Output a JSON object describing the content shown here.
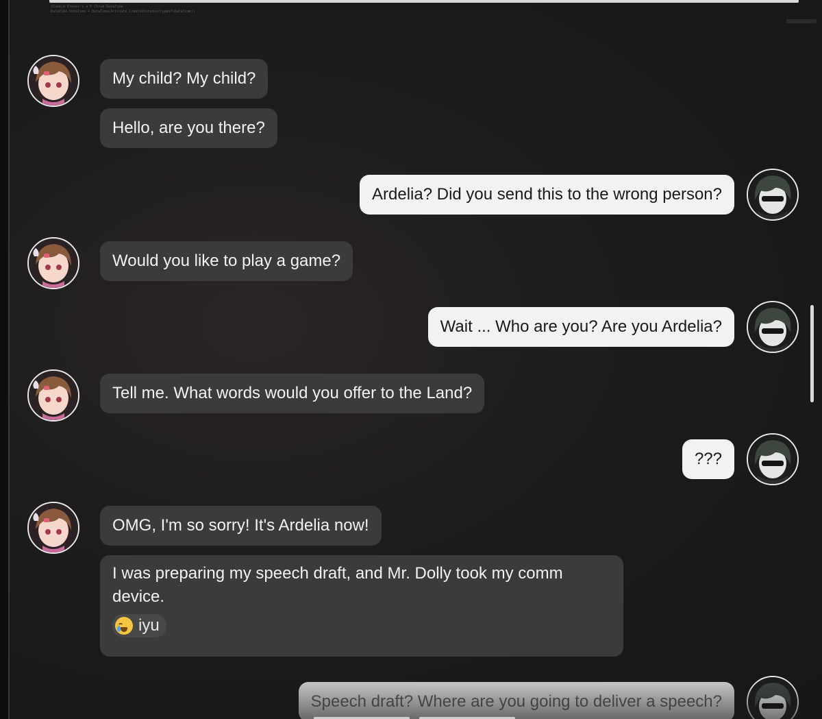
{
  "debug": {
    "line1": "[Cube(e Kronkx's a P Ctrim DataTime",
    "line2": "DataTime.DataTime + DataTime(Activate.CreateInstance(typeof(DataTime))"
  },
  "messages": [
    {
      "sender": "ardelia",
      "text": "My child? My child?"
    },
    {
      "sender": "ardelia",
      "text": "Hello, are you there?"
    },
    {
      "sender": "player",
      "text": "Ardelia? Did you send this to the wrong person?"
    },
    {
      "sender": "ardelia",
      "text": "Would you like to play a game?"
    },
    {
      "sender": "player",
      "text": "Wait ... Who are you? Are you Ardelia?"
    },
    {
      "sender": "ardelia",
      "text": "Tell me. What words would you offer to the Land?"
    },
    {
      "sender": "player",
      "text": "???"
    },
    {
      "sender": "ardelia",
      "text": "OMG, I'm so sorry! It's Ardelia now!"
    },
    {
      "sender": "ardelia",
      "text": "I was preparing my speech draft, and Mr. Dolly took my comm device.",
      "reaction": {
        "icon": "crying-face-icon",
        "label": "iyu"
      }
    },
    {
      "sender": "player",
      "text": "Speech draft? Where are you going to deliver a speech?"
    }
  ],
  "avatars": {
    "ardelia": {
      "icon": "ardelia-avatar",
      "hair_color": "#8a5a3c",
      "skin_color": "#f6d7cc"
    },
    "player": {
      "icon": "endministrator-avatar",
      "hair_color": "#3e4640",
      "skin_color": "#e3e6e2"
    }
  }
}
